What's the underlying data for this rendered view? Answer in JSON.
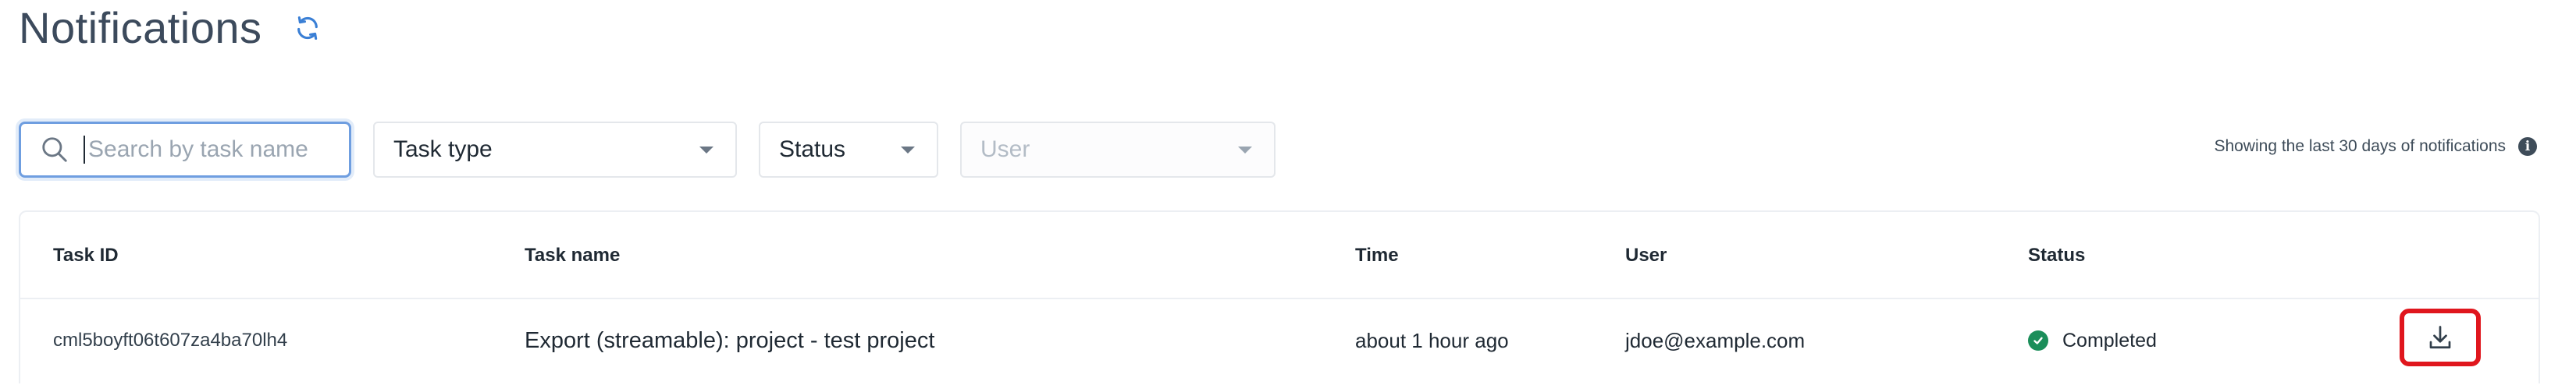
{
  "header": {
    "title": "Notifications",
    "refresh_icon": "refresh-icon"
  },
  "filters": {
    "search": {
      "placeholder": "Search by task name",
      "value": "",
      "icon": "search-icon"
    },
    "task_type": {
      "label": "Task type"
    },
    "status": {
      "label": "Status"
    },
    "user": {
      "label": "User",
      "disabled": true
    }
  },
  "notice": {
    "text": "Showing the last 30 days of notifications",
    "icon": "info-icon"
  },
  "table": {
    "columns": [
      "Task ID",
      "Task name",
      "Time",
      "User",
      "Status"
    ],
    "rows": [
      {
        "task_id": "cml5boyft06t607za4ba70lh4",
        "task_name": "Export (streamable): project - test project",
        "time": "about 1 hour ago",
        "user": "jdoe@example.com",
        "status": "Completed",
        "status_icon": "check-circle-icon",
        "action_icon": "download-icon"
      }
    ]
  },
  "colors": {
    "title": "#3c4a5c",
    "accent": "#3a7fd5",
    "success": "#1b8e5a",
    "highlight": "#e0161d"
  }
}
